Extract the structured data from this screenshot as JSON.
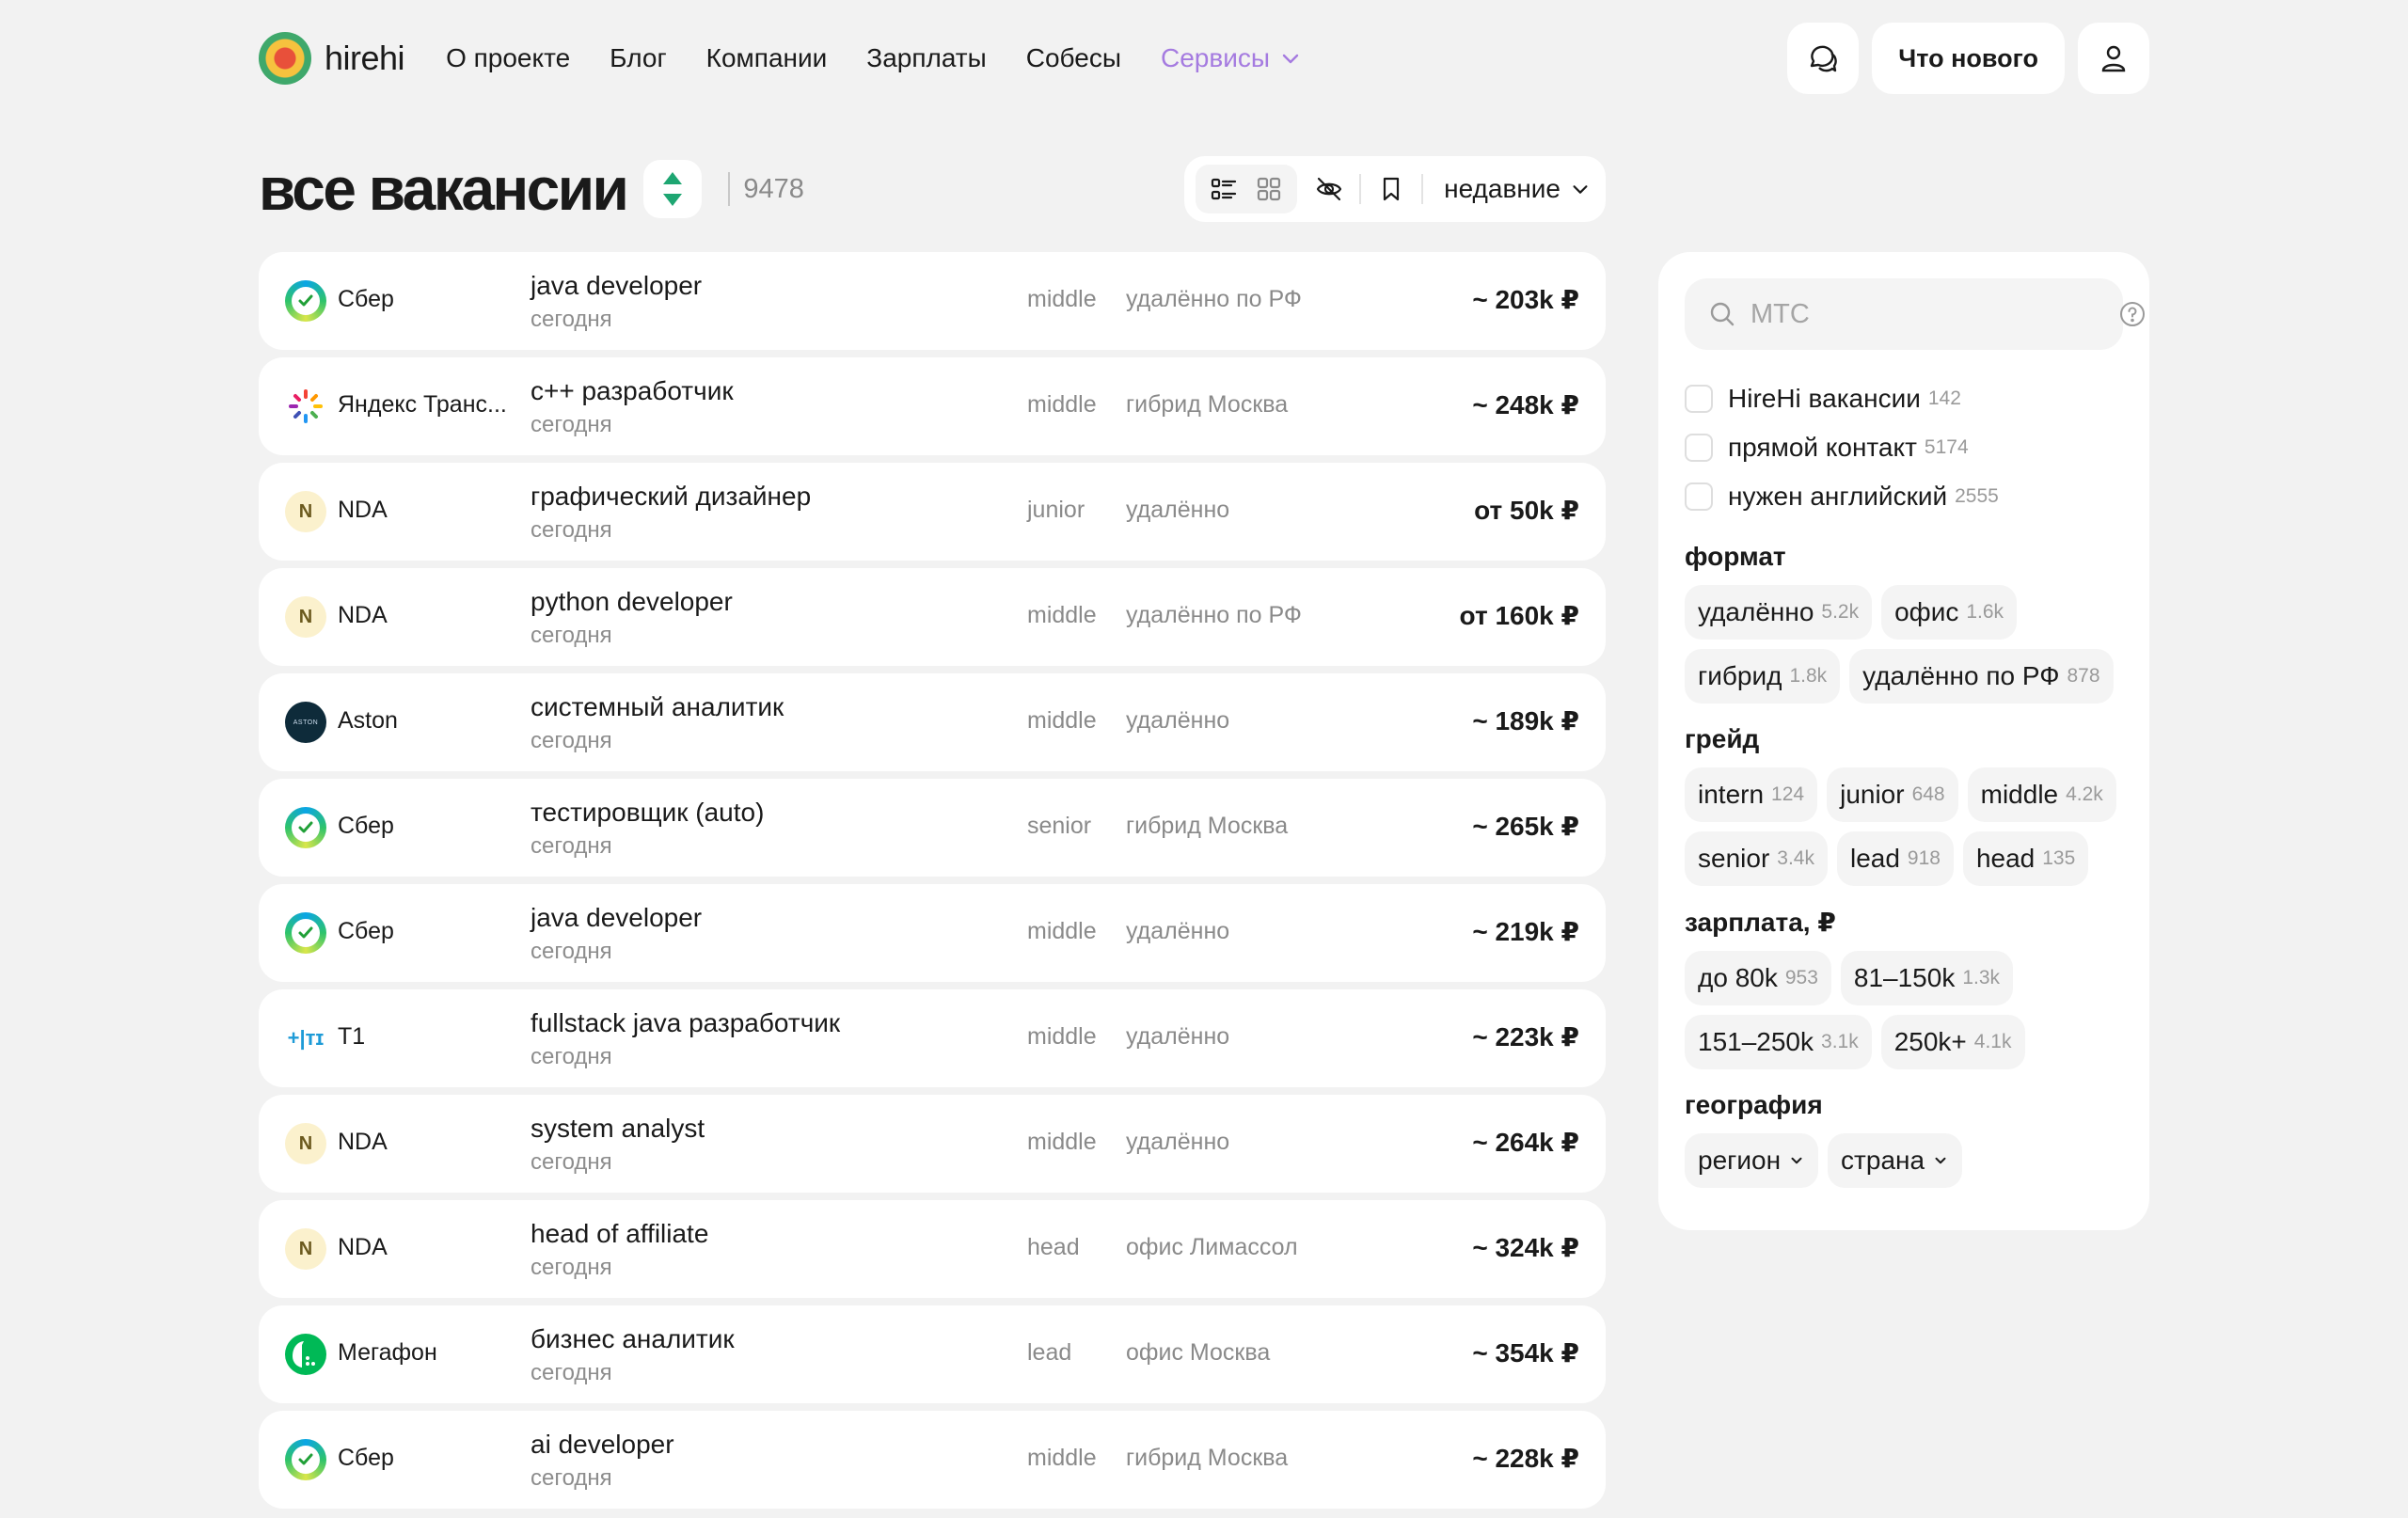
{
  "brand": {
    "name": "hirehi"
  },
  "nav": {
    "items": [
      "О проекте",
      "Блог",
      "Компании",
      "Зарплаты",
      "Собесы"
    ],
    "services": "Сервисы"
  },
  "header": {
    "whats_new": "Что нового"
  },
  "title": {
    "text": "все вакансии",
    "count": "9478"
  },
  "toolbar": {
    "sort": "недавние"
  },
  "jobs": [
    {
      "company": "Сбер",
      "logo": "sber",
      "title": "java developer",
      "date": "сегодня",
      "grade": "middle",
      "location": "удалённо по РФ",
      "salary": "~ 203k ₽"
    },
    {
      "company": "Яндекс Транс...",
      "logo": "yandex",
      "title": "c++ разработчик",
      "date": "сегодня",
      "grade": "middle",
      "location": "гибрид Москва",
      "salary": "~ 248k ₽"
    },
    {
      "company": "NDA",
      "logo": "nda",
      "title": "графический дизайнер",
      "date": "сегодня",
      "grade": "junior",
      "location": "удалённо",
      "salary": "от 50k ₽"
    },
    {
      "company": "NDA",
      "logo": "nda",
      "title": "python developer",
      "date": "сегодня",
      "grade": "middle",
      "location": "удалённо по РФ",
      "salary": "от 160k ₽"
    },
    {
      "company": "Aston",
      "logo": "aston",
      "title": "системный аналитик",
      "date": "сегодня",
      "grade": "middle",
      "location": "удалённо",
      "salary": "~ 189k ₽"
    },
    {
      "company": "Сбер",
      "logo": "sber",
      "title": "тестировщик (auto)",
      "date": "сегодня",
      "grade": "senior",
      "location": "гибрид Москва",
      "salary": "~ 265k ₽"
    },
    {
      "company": "Сбер",
      "logo": "sber",
      "title": "java developer",
      "date": "сегодня",
      "grade": "middle",
      "location": "удалённо",
      "salary": "~ 219k ₽"
    },
    {
      "company": "T1",
      "logo": "t1",
      "title": "fullstack java разработчик",
      "date": "сегодня",
      "grade": "middle",
      "location": "удалённо",
      "salary": "~ 223k ₽"
    },
    {
      "company": "NDA",
      "logo": "nda",
      "title": "system analyst",
      "date": "сегодня",
      "grade": "middle",
      "location": "удалённо",
      "salary": "~ 264k ₽"
    },
    {
      "company": "NDA",
      "logo": "nda",
      "title": "head of affiliate",
      "date": "сегодня",
      "grade": "head",
      "location": "офис Лимассол",
      "salary": "~ 324k ₽"
    },
    {
      "company": "Мегафон",
      "logo": "megafon",
      "title": "бизнес аналитик",
      "date": "сегодня",
      "grade": "lead",
      "location": "офис Москва",
      "salary": "~ 354k ₽"
    },
    {
      "company": "Сбер",
      "logo": "sber",
      "title": "ai developer",
      "date": "сегодня",
      "grade": "middle",
      "location": "гибрид Москва",
      "salary": "~ 228k ₽"
    }
  ],
  "filters": {
    "search": {
      "value": "",
      "placeholder": "МТС"
    },
    "checkboxes": [
      {
        "label": "HireHi вакансии",
        "count": "142"
      },
      {
        "label": "прямой контакт",
        "count": "5174"
      },
      {
        "label": "нужен английский",
        "count": "2555"
      }
    ],
    "format": {
      "title": "формат",
      "chips": [
        {
          "label": "удалённо",
          "count": "5.2k"
        },
        {
          "label": "офис",
          "count": "1.6k"
        },
        {
          "label": "гибрид",
          "count": "1.8k"
        },
        {
          "label": "удалённо по РФ",
          "count": "878"
        }
      ]
    },
    "grade": {
      "title": "грейд",
      "chips": [
        {
          "label": "intern",
          "count": "124"
        },
        {
          "label": "junior",
          "count": "648"
        },
        {
          "label": "middle",
          "count": "4.2k"
        },
        {
          "label": "senior",
          "count": "3.4k"
        },
        {
          "label": "lead",
          "count": "918"
        },
        {
          "label": "head",
          "count": "135"
        }
      ]
    },
    "salary": {
      "title": "зарплата, ₽",
      "chips": [
        {
          "label": "до 80k",
          "count": "953"
        },
        {
          "label": "81–150k",
          "count": "1.3k"
        },
        {
          "label": "151–250k",
          "count": "3.1k"
        },
        {
          "label": "250k+",
          "count": "4.1k"
        }
      ]
    },
    "geo": {
      "title": "география",
      "dropdowns": [
        "регион",
        "страна"
      ]
    }
  },
  "colors": {
    "accent_services": "#a57be0",
    "sort_toggle": "#1ea672",
    "background": "#f2f2f2"
  },
  "icons": {
    "chat": "chat-icon",
    "user": "user-icon",
    "list_view": "list-view-icon",
    "grid_view": "grid-view-icon",
    "hide": "eye-off-icon",
    "bookmark": "bookmark-icon",
    "search": "search-icon",
    "help": "help-icon"
  }
}
